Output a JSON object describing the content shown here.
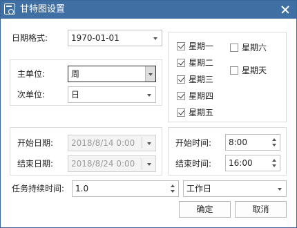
{
  "window": {
    "title": "甘特图设置"
  },
  "date_format": {
    "label": "日期格式:",
    "value": "1970-01-01"
  },
  "units": {
    "major_label": "主单位:",
    "major_value": "周",
    "minor_label": "次单位:",
    "minor_value": "日"
  },
  "weekdays": [
    {
      "label": "星期一",
      "checked": true
    },
    {
      "label": "星期二",
      "checked": true
    },
    {
      "label": "星期三",
      "checked": true
    },
    {
      "label": "星期四",
      "checked": true
    },
    {
      "label": "星期五",
      "checked": true
    },
    {
      "label": "星期六",
      "checked": false
    },
    {
      "label": "星期天",
      "checked": false
    }
  ],
  "dates": {
    "start_label": "开始日期:",
    "start_value": "2018/8/14 0:00",
    "end_label": "结束日期:",
    "end_value": "2018/8/24 0:00"
  },
  "times": {
    "start_label": "开始时间:",
    "start_value": "8:00",
    "end_label": "结束时间:",
    "end_value": "16:00"
  },
  "duration": {
    "label": "任务持续时间:",
    "value": "1.0",
    "unit": "工作日"
  },
  "buttons": {
    "ok": "确定",
    "cancel": "取消"
  },
  "colors": {
    "titlebar": "#3f6fa3",
    "border": "#dcdcdc"
  }
}
